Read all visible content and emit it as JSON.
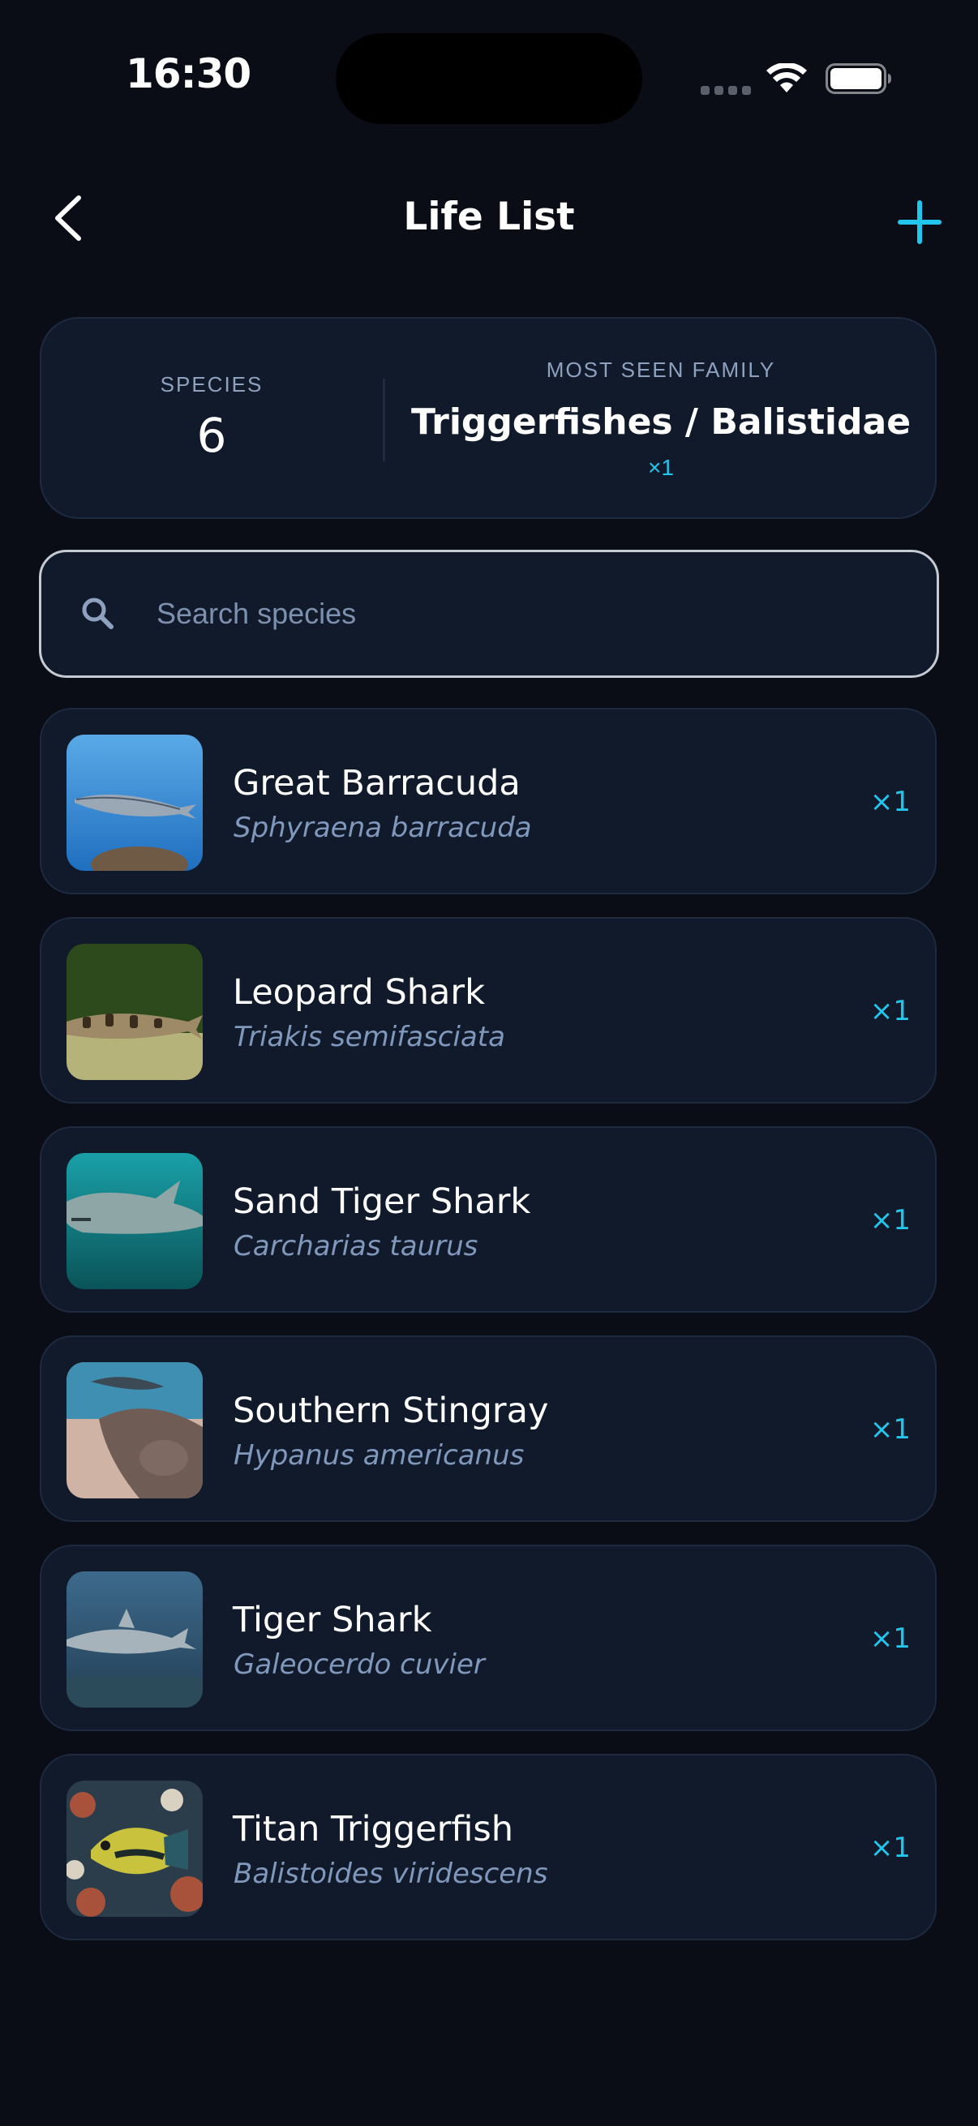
{
  "status_bar": {
    "time": "16:30"
  },
  "nav": {
    "title": "Life List",
    "back_icon": "chevron-left-icon",
    "add_icon": "plus-icon",
    "accent_color": "#22c6ec"
  },
  "stats": {
    "species_label": "SPECIES",
    "species_value": "6",
    "family_label": "MOST SEEN FAMILY",
    "family_value": "Triggerfishes / Balistidae",
    "family_count": "×1"
  },
  "search": {
    "placeholder": "Search species",
    "value": ""
  },
  "species": [
    {
      "common_name": "Great Barracuda",
      "scientific_name": "Sphyraena barracuda",
      "count": "×1"
    },
    {
      "common_name": "Leopard Shark",
      "scientific_name": "Triakis semifasciata",
      "count": "×1"
    },
    {
      "common_name": "Sand Tiger Shark",
      "scientific_name": "Carcharias taurus",
      "count": "×1"
    },
    {
      "common_name": "Southern Stingray",
      "scientific_name": "Hypanus americanus",
      "count": "×1"
    },
    {
      "common_name": "Tiger Shark",
      "scientific_name": "Galeocerdo cuvier",
      "count": "×1"
    },
    {
      "common_name": "Titan Triggerfish",
      "scientific_name": "Balistoides viridescens",
      "count": "×1"
    }
  ]
}
